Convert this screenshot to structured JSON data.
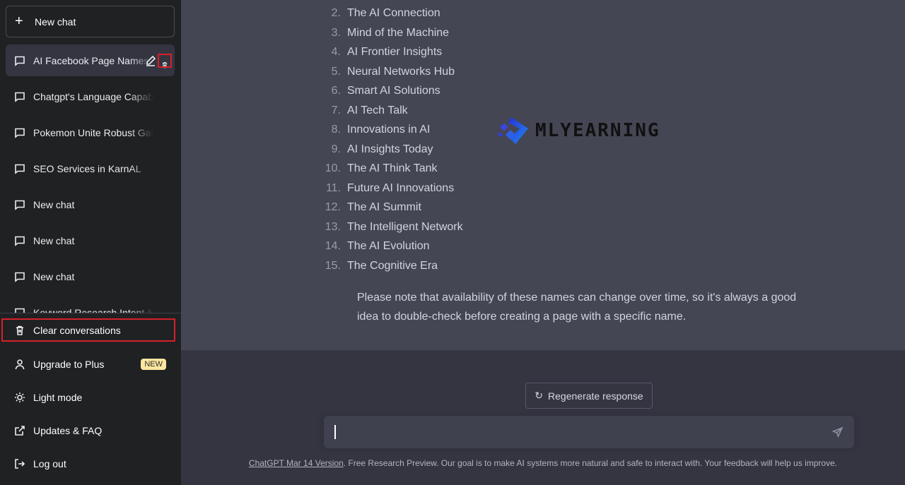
{
  "sidebar": {
    "new_chat": "New chat",
    "history": [
      {
        "label": "AI Facebook Page Names",
        "active": true
      },
      {
        "label": "Chatgpt's Language Capabilities"
      },
      {
        "label": "Pokemon Unite Robust Games"
      },
      {
        "label": "SEO Services in KarnAL"
      },
      {
        "label": "New chat"
      },
      {
        "label": "New chat"
      },
      {
        "label": "New chat"
      },
      {
        "label": "Keyword Research Intent Analysis"
      }
    ],
    "clear": "Clear conversations",
    "upgrade": "Upgrade to Plus",
    "badge": "NEW",
    "light": "Light mode",
    "updates": "Updates & FAQ",
    "logout": "Log out",
    "highlight_color": "#d6202a"
  },
  "answer": {
    "list": [
      {
        "n": "2.",
        "t": "The AI Connection"
      },
      {
        "n": "3.",
        "t": "Mind of the Machine"
      },
      {
        "n": "4.",
        "t": "AI Frontier Insights"
      },
      {
        "n": "5.",
        "t": "Neural Networks Hub"
      },
      {
        "n": "6.",
        "t": "Smart AI Solutions"
      },
      {
        "n": "7.",
        "t": "AI Tech Talk"
      },
      {
        "n": "8.",
        "t": "Innovations in AI"
      },
      {
        "n": "9.",
        "t": "AI Insights Today"
      },
      {
        "n": "10.",
        "t": "The AI Think Tank"
      },
      {
        "n": "11.",
        "t": "Future AI Innovations"
      },
      {
        "n": "12.",
        "t": "The AI Summit"
      },
      {
        "n": "13.",
        "t": "The Intelligent Network"
      },
      {
        "n": "14.",
        "t": "The AI Evolution"
      },
      {
        "n": "15.",
        "t": "The Cognitive Era"
      }
    ],
    "note": "Please note that availability of these names can change over time, so it's always a good idea to double-check before creating a page with a specific name."
  },
  "watermark": "MLYEARNING",
  "regenerate": "Regenerate response",
  "input": {
    "value": ""
  },
  "footer": {
    "link": "ChatGPT Mar 14 Version",
    "text": ". Free Research Preview. Our goal is to make AI systems more natural and safe to interact with. Your feedback will help us improve."
  }
}
